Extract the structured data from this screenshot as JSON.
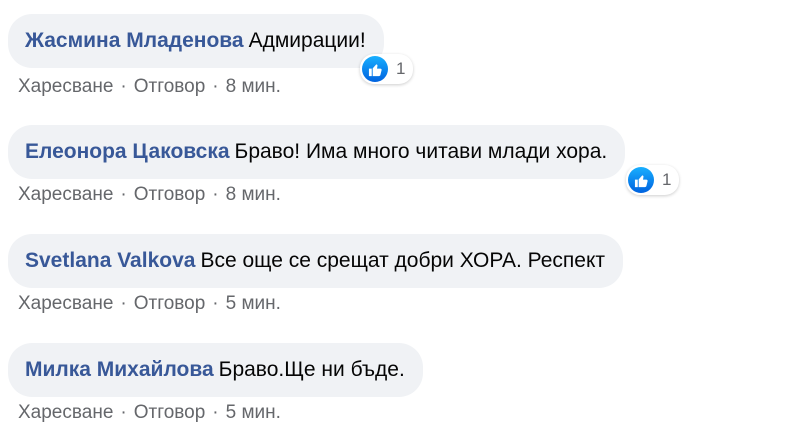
{
  "comments": [
    {
      "author": "Жасмина Младенова",
      "text": "Адмирации!",
      "reactions": "1",
      "like": "Харесване",
      "reply": "Отговор",
      "time": "8 мин."
    },
    {
      "author": "Елеонора Цаковска",
      "text": "Браво! Има много читави млади хора.",
      "reactions": "1",
      "like": "Харесване",
      "reply": "Отговор",
      "time": "8 мин."
    },
    {
      "author": "Svetlana Valkova",
      "text": "Все още се срещат добри ХОРА. Респект",
      "like": "Харесване",
      "reply": "Отговор",
      "time": "5 мин."
    },
    {
      "author": "Милка Михайлова",
      "text": "Браво.Ще ни бъде.",
      "like": "Харесване",
      "reply": "Отговор",
      "time": "5 мин."
    }
  ],
  "separator": "·",
  "icons": {
    "reaction": "like-icon"
  },
  "colors": {
    "author": "#385898",
    "bubble": "#f0f2f5",
    "meta": "#65676b",
    "like": "#1877f2"
  }
}
